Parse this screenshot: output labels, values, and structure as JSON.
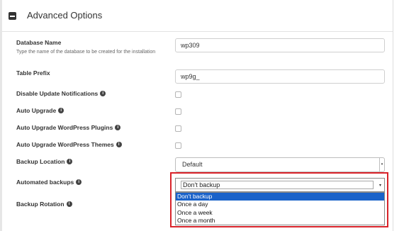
{
  "section": {
    "title": "Advanced Options"
  },
  "fields": {
    "database_name": {
      "label": "Database Name",
      "description": "Type the name of the database to be created for the installation",
      "value": "wp309"
    },
    "table_prefix": {
      "label": "Table Prefix",
      "value": "wp9g_"
    },
    "disable_update_notifications": {
      "label": "Disable Update Notifications",
      "checked": false
    },
    "auto_upgrade": {
      "label": "Auto Upgrade",
      "checked": false
    },
    "auto_upgrade_plugins": {
      "label": "Auto Upgrade WordPress Plugins",
      "checked": false
    },
    "auto_upgrade_themes": {
      "label": "Auto Upgrade WordPress Themes",
      "checked": false
    },
    "backup_location": {
      "label": "Backup Location",
      "selected": "Default"
    },
    "automated_backups": {
      "label": "Automated backups",
      "selected": "Don't backup",
      "options": [
        "Don't backup",
        "Once a day",
        "Once a week",
        "Once a month"
      ]
    },
    "backup_rotation": {
      "label": "Backup Rotation"
    }
  },
  "icons": {
    "info": "i",
    "collapse": "minus-square-icon",
    "select_arrow": "▾",
    "dropdown_arrow": "▾"
  },
  "colors": {
    "highlight": "#d9232a",
    "selected_option": "#1a62c9"
  }
}
